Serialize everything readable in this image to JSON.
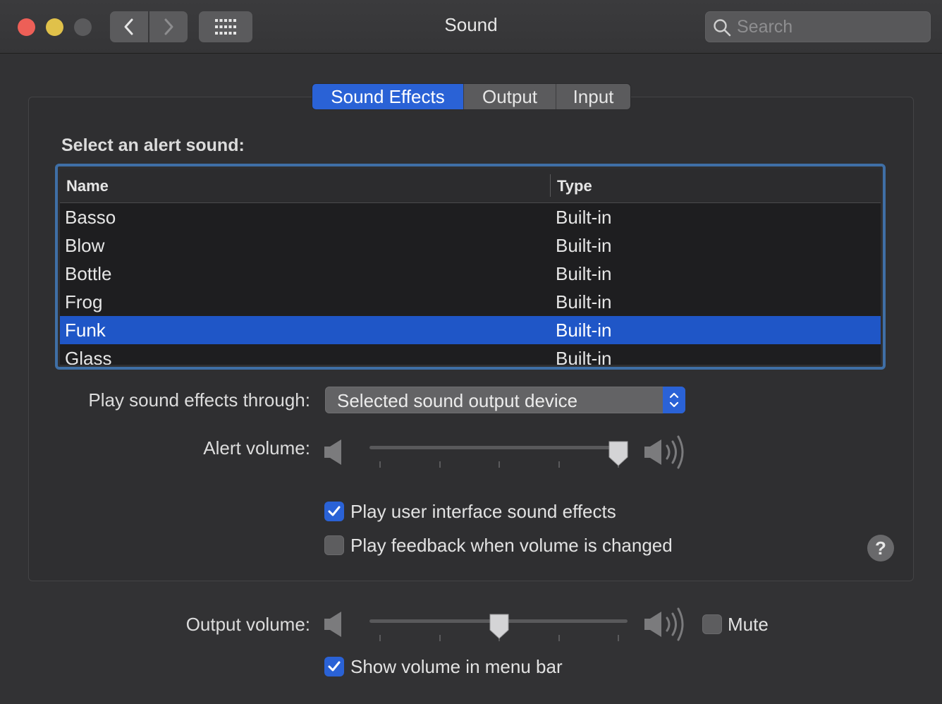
{
  "window": {
    "title": "Sound",
    "search_placeholder": "Search"
  },
  "tabs": [
    {
      "label": "Sound Effects",
      "active": true
    },
    {
      "label": "Output",
      "active": false
    },
    {
      "label": "Input",
      "active": false
    }
  ],
  "alert_sounds": {
    "heading": "Select an alert sound:",
    "columns": {
      "name": "Name",
      "type": "Type"
    },
    "rows": [
      {
        "name": "Basso",
        "type": "Built-in"
      },
      {
        "name": "Blow",
        "type": "Built-in"
      },
      {
        "name": "Bottle",
        "type": "Built-in"
      },
      {
        "name": "Frog",
        "type": "Built-in"
      },
      {
        "name": "Funk",
        "type": "Built-in"
      },
      {
        "name": "Glass",
        "type": "Built-in"
      }
    ],
    "selected": "Funk"
  },
  "play_through": {
    "label": "Play sound effects through:",
    "value": "Selected sound output device"
  },
  "alert_volume": {
    "label": "Alert volume:",
    "level": 1.0
  },
  "options": {
    "ui_sounds": {
      "label": "Play user interface sound effects",
      "checked": true
    },
    "feedback": {
      "label": "Play feedback when volume is changed",
      "checked": false
    }
  },
  "output_volume": {
    "label": "Output volume:",
    "level": 0.5,
    "mute_label": "Mute",
    "muted": false
  },
  "menu_bar": {
    "label": "Show volume in menu bar",
    "checked": true
  },
  "help": {
    "glyph": "?"
  },
  "colors": {
    "accent": "#2a62d6",
    "background": "#323234",
    "selection": "#1f56c7"
  }
}
